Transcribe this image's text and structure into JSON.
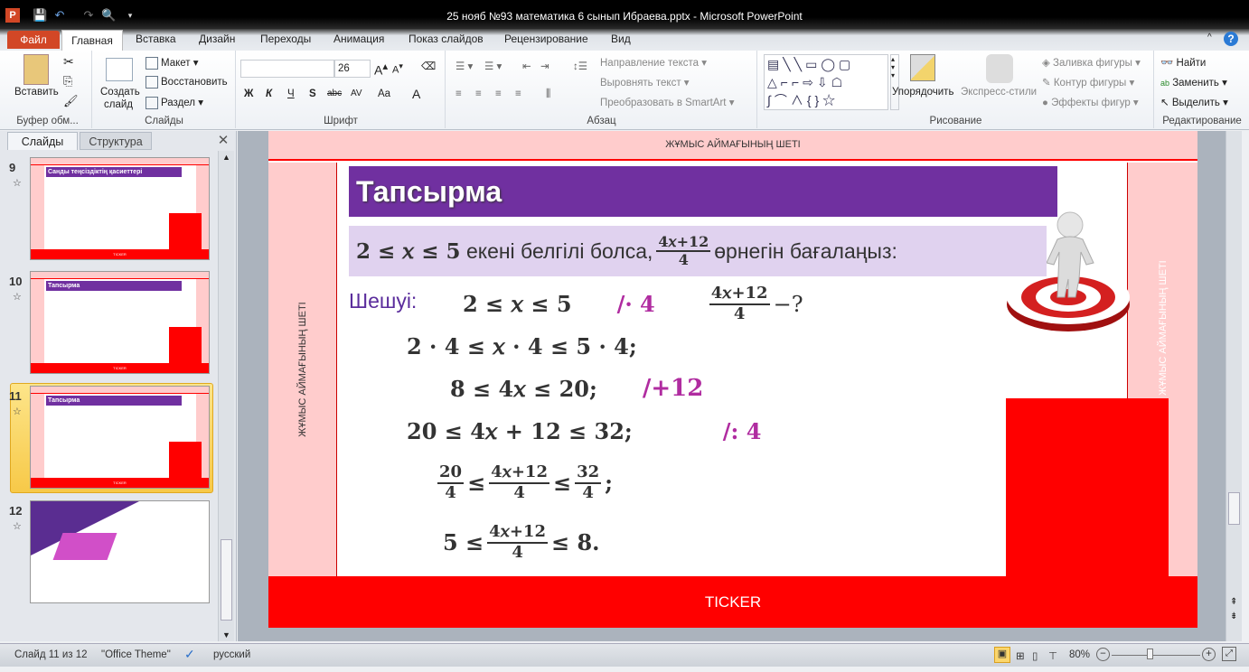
{
  "window": {
    "title": "25 нояб №93 математика 6 сынып Ибраева.pptx  -  Microsoft PowerPoint"
  },
  "tabs": [
    "Файл",
    "Главная",
    "Вставка",
    "Дизайн",
    "Переходы",
    "Анимация",
    "Показ слайдов",
    "Рецензирование",
    "Вид"
  ],
  "ribbon": {
    "clipboard": {
      "paste": "Вставить",
      "label": "Буфер обм..."
    },
    "slides": {
      "new_slide_1": "Создать",
      "new_slide_2": "слайд",
      "layout": "Макет",
      "reset": "Восстановить",
      "section": "Раздел",
      "label": "Слайды"
    },
    "font": {
      "font_name": "",
      "font_size": "26",
      "bold": "Ж",
      "italic": "К",
      "underline": "Ч",
      "shadow": "S",
      "strike": "abc",
      "spacing": "AV",
      "case": "Aa",
      "color": "A",
      "label": "Шрифт"
    },
    "paragraph": {
      "text_direction": "Направление текста",
      "align_text": "Выровнять текст",
      "smartart": "Преобразовать в SmartArt",
      "label": "Абзац"
    },
    "drawing": {
      "arrange": "Упорядочить",
      "quick_styles": "Экспресс-стили",
      "fill": "Заливка фигуры",
      "outline": "Контур фигуры",
      "effects": "Эффекты фигур",
      "label": "Рисование"
    },
    "editing": {
      "find": "Найти",
      "replace": "Заменить",
      "select": "Выделить",
      "label": "Редактирование"
    }
  },
  "panel": {
    "tab_slides": "Слайды",
    "tab_outline": "Структура",
    "thumbs": [
      {
        "num": "9",
        "title": "Санды теңсіздіктің қасиеттері",
        "ticker": "TICKER"
      },
      {
        "num": "10",
        "title": "Тапсырма",
        "ticker": "TICKER"
      },
      {
        "num": "11",
        "title": "Тапсырма",
        "ticker": "TICKER"
      },
      {
        "num": "12",
        "title": "",
        "ticker": ""
      }
    ]
  },
  "slide": {
    "top_band": "ЖҰМЫС АЙМАҒЫНЫҢ ШЕТІ",
    "left_band": "ЖҰМЫС АЙМАҒЫНЫҢ ШЕТІ",
    "right_band": "ЖҰМЫС АЙМАҒЫНЫҢ ШЕТІ",
    "ticker": "TICKER",
    "title": "Тапсырма",
    "task": {
      "cond": "2 ≤ 𝑥 ≤ 5",
      "text1": "екені белгілі болса,",
      "num": "4𝑥+12",
      "den": "4",
      "text2": "өрнегін бағалаңыз:"
    },
    "solution_label": "Шешуі:",
    "lines": {
      "l1": "2 ≤ 𝑥 ≤ 5",
      "l1op": "/· 4",
      "l1num": "4𝑥+12",
      "l1den": "4",
      "l1q": "−?",
      "l2": "2 · 4 ≤ 𝑥 · 4 ≤ 5 · 4;",
      "l3": "8 ≤ 4𝑥 ≤ 20;",
      "l3op": "/+12",
      "l4": "20 ≤ 4𝑥 + 12 ≤ 32;",
      "l4op": "/: 4",
      "l5a_num": "20",
      "l5a_den": "4",
      "l5le": "≤",
      "l5b_num": "4𝑥+12",
      "l5b_den": "4",
      "l5le2": "≤",
      "l5c_num": "32",
      "l5c_den": "4",
      "l5end": ";",
      "l6a": "5 ≤",
      "l6num": "4𝑥+12",
      "l6den": "4",
      "l6b": "≤ 8."
    }
  },
  "status": {
    "slide": "Слайд 11 из 12",
    "theme": "\"Office Theme\"",
    "lang": "русский",
    "zoom": "80%",
    "zoom_fraction": 0.4
  }
}
